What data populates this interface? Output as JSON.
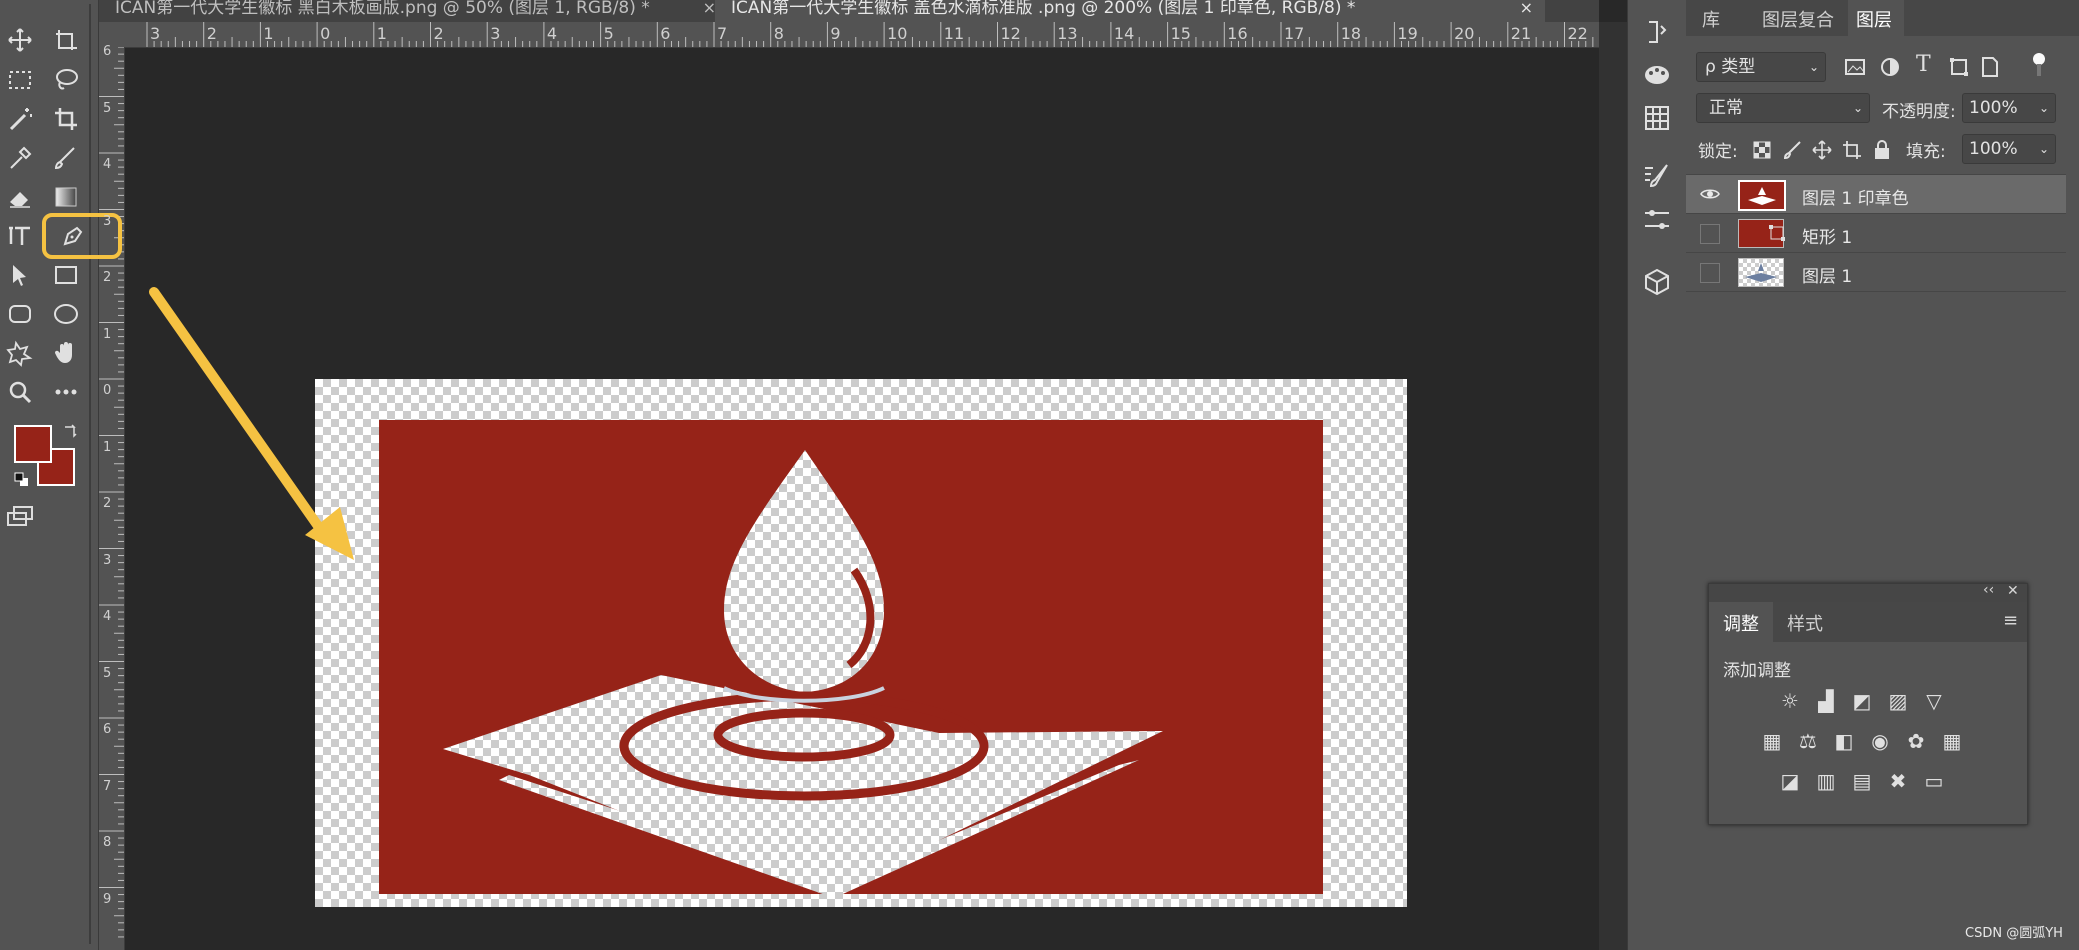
{
  "tabs": [
    {
      "label": "ICAN第一代大学生徽标 黑白木板画版.png @ 50% (图层 1, RGB/8) *",
      "close": "×"
    },
    {
      "label": "ICAN第一代大学生徽标 盖色水滴标准版 .png @ 200% (图层 1 印章色, RGB/8) *",
      "close": "×"
    }
  ],
  "ruler_top": [
    "3",
    "2",
    "1",
    "0",
    "1",
    "2",
    "3",
    "4",
    "5",
    "6",
    "7",
    "8",
    "9",
    "10",
    "11",
    "12",
    "13",
    "14",
    "15",
    "16",
    "17",
    "18",
    "19",
    "20",
    "21",
    "22"
  ],
  "ruler_left": [
    "6",
    "5",
    "4",
    "3",
    "2",
    "1",
    "0",
    "1",
    "2",
    "3",
    "4",
    "5",
    "6",
    "7",
    "8",
    "9"
  ],
  "toolbar": {
    "tools": [
      "move-icon",
      "artboard-icon",
      "marquee-icon",
      "lasso-icon",
      "magic-wand-icon",
      "crop-icon",
      "eyedropper-icon",
      "brush-icon",
      "eraser-icon",
      "gradient-icon",
      "type-icon",
      "pen-icon",
      "path-select-icon",
      "rectangle-icon",
      "rounded-rect-icon",
      "ellipse-icon",
      "custom-shape-icon",
      "hand-icon",
      "zoom-icon",
      "more-icon"
    ],
    "selected_tool": "pen-icon",
    "foreground_color": "#962318",
    "background_color": "#962318",
    "highlight_color": "#f5c242"
  },
  "canvas": {
    "stamp_color": "#962318",
    "arrow_color": "#f5c242"
  },
  "panel": {
    "tabs": [
      "库",
      "图层复合",
      "图层"
    ],
    "active_tab": "图层",
    "filter_label": "ρ 类型",
    "blend_mode": "正常",
    "opacity_label": "不透明度:",
    "opacity_value": "100%",
    "lock_label": "锁定:",
    "fill_label": "填充:",
    "fill_value": "100%",
    "layers": [
      {
        "name": "图层 1 印章色",
        "visible": true,
        "active": true
      },
      {
        "name": "矩形 1",
        "visible": false,
        "active": false
      },
      {
        "name": "图层 1",
        "visible": false,
        "active": false
      }
    ]
  },
  "adjustments": {
    "tabs": [
      "调整",
      "样式"
    ],
    "active_tab": "调整",
    "heading": "添加调整",
    "collapse": "‹‹",
    "close": "✕",
    "menu": "≡",
    "rows": [
      [
        "☼",
        "▟",
        "◩",
        "▨",
        "▽"
      ],
      [
        "▦",
        "⚖",
        "◧",
        "◉",
        "✿",
        "▦"
      ],
      [
        "◪",
        "▥",
        "▤",
        "✖",
        "▭"
      ]
    ]
  },
  "watermark": "CSDN @圆弧YH"
}
